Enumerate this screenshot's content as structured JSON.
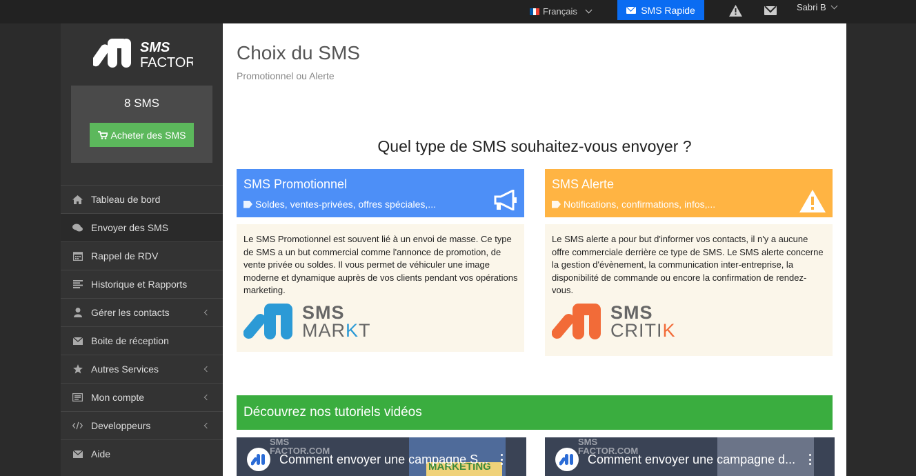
{
  "topbar": {
    "language": "Français",
    "sms_rapide": "SMS Rapide",
    "user": "Sabri B",
    "flag_colors": [
      "#0055a4",
      "#ffffff",
      "#ef4135"
    ]
  },
  "sidebar": {
    "logo_line1": "SMS",
    "logo_line2": "FACTOR",
    "balance": "8 SMS",
    "buy_button": "Acheter des SMS",
    "items": [
      {
        "label": "Tableau de bord",
        "icon": "home-icon"
      },
      {
        "label": "Envoyer des SMS",
        "icon": "comments-icon"
      },
      {
        "label": "Rappel de RDV",
        "icon": "calendar-icon"
      },
      {
        "label": "Historique et Rapports",
        "icon": "list-icon"
      },
      {
        "label": "Gérer les contacts",
        "icon": "user-icon"
      },
      {
        "label": "Boite de réception",
        "icon": "envelope-icon"
      },
      {
        "label": "Autres Services",
        "icon": "star-icon"
      },
      {
        "label": "Mon compte",
        "icon": "id-card-icon"
      },
      {
        "label": "Developpeurs",
        "icon": "code-icon"
      },
      {
        "label": "Aide",
        "icon": "envelope-icon"
      }
    ]
  },
  "main": {
    "title": "Choix du SMS",
    "subtitle": "Promotionnel ou Alerte",
    "question": "Quel type de SMS souhaitez-vous envoyer ?",
    "promo": {
      "title": "SMS Promotionnel",
      "tags": "Soldes, ventes-privées, offres spéciales,...",
      "text": "Le SMS Promotionnel est souvent lié à un envoi de masse. Ce type de SMS a un but commercial comme l'annonce de promotion, de vente privée ou soldes. Il vous permet de véhiculer une image moderne et dynamique auprès de vos clients pendant vos opérations marketing.",
      "brand_sms": "SMS",
      "brand_name_a": "MAR",
      "brand_name_b": "K",
      "brand_name_c": "T",
      "color": "#4d8ff7",
      "brand_color": "#2b9ad6"
    },
    "alert": {
      "title": "SMS Alerte",
      "tags": "Notifications, confirmations, infos,...",
      "text": "Le SMS alerte a pour but d'informer vos contacts, il n'y a aucune offre commerciale derrière ce type de SMS. Le SMS alerte concerne la gestion d'évènement, la communication inter-entreprise, la disponibilité de commande ou encore la confirmation de rendez-vous.",
      "brand_sms": "SMS",
      "brand_name_a": "CRITI",
      "brand_name_b": "K",
      "color": "#ffb443",
      "brand_color": "#f26b38"
    },
    "tutorials": {
      "heading": "Découvrez nos tutoriels vidéos",
      "videos": [
        {
          "title": "Comment envoyer une campagne S...",
          "watermark1": "SMS",
          "watermark2": "FACTOR.COM",
          "thumb_text": "MARKETING"
        },
        {
          "title": "Comment envoyer une campagne d...",
          "watermark1": "SMS",
          "watermark2": "FACTOR.COM"
        }
      ]
    }
  }
}
